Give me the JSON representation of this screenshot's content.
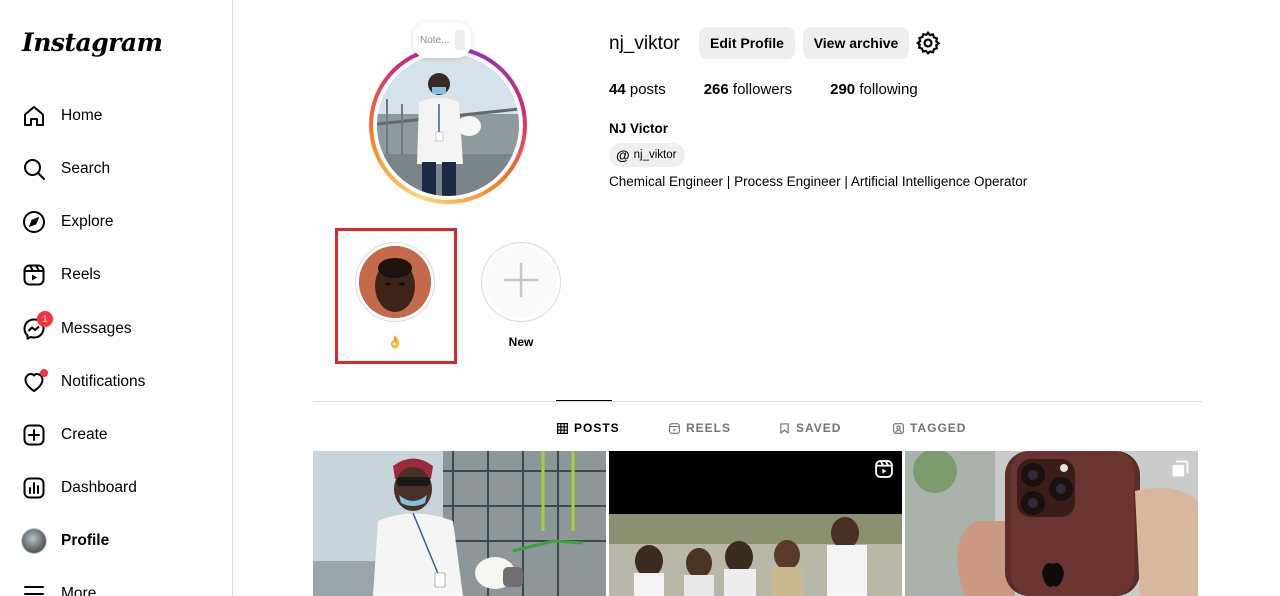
{
  "sidebar": {
    "logo": "Instagram",
    "items": [
      {
        "label": "Home",
        "icon": "home-icon"
      },
      {
        "label": "Search",
        "icon": "search-icon"
      },
      {
        "label": "Explore",
        "icon": "compass-icon"
      },
      {
        "label": "Reels",
        "icon": "reels-icon"
      },
      {
        "label": "Messages",
        "icon": "messenger-icon",
        "badge": "1"
      },
      {
        "label": "Notifications",
        "icon": "heart-icon"
      },
      {
        "label": "Create",
        "icon": "plus-square-icon"
      },
      {
        "label": "Dashboard",
        "icon": "dashboard-icon"
      },
      {
        "label": "Profile",
        "icon": "avatar"
      },
      {
        "label": "More",
        "icon": "menu-icon"
      }
    ]
  },
  "profile": {
    "note_placeholder": "Note...",
    "username": "nj_viktor",
    "edit_profile_label": "Edit Profile",
    "view_archive_label": "View archive",
    "stats": {
      "posts_count": "44",
      "posts_label": "posts",
      "followers_count": "266",
      "followers_label": "followers",
      "following_count": "290",
      "following_label": "following"
    },
    "full_name": "NJ Victor",
    "threads_handle": "nj_viktor",
    "bio": "Chemical Engineer | Process Engineer | Artificial Intelligence Operator"
  },
  "highlights": [
    {
      "label": "👌"
    },
    {
      "label": "New"
    }
  ],
  "tabs": [
    {
      "label": "POSTS",
      "icon": "grid-icon",
      "active": true
    },
    {
      "label": "REELS",
      "icon": "reels-icon",
      "active": false
    },
    {
      "label": "SAVED",
      "icon": "bookmark-icon",
      "active": false
    },
    {
      "label": "TAGGED",
      "icon": "tagged-icon",
      "active": false
    }
  ],
  "colors": {
    "accent_red": "#ff3040",
    "highlight_outline": "#e1262b",
    "button_bg": "#efefef",
    "border": "#dbdbdb"
  }
}
